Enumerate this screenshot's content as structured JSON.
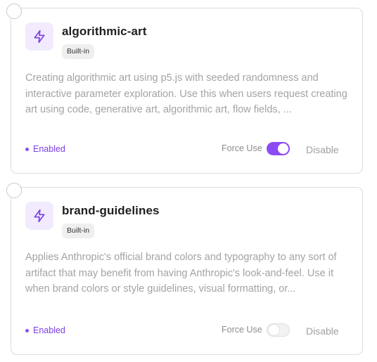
{
  "accent_color": "#8c4bf2",
  "skills": [
    {
      "name": "algorithmic-art",
      "badge": "Built-in",
      "icon": "lightning-bolt-icon",
      "description": "Creating algorithmic art using p5.js with seeded randomness and interactive parameter exploration. Use this when users request creating art using code, generative art, algorithmic art, flow fields, ...",
      "status": "Enabled",
      "force_use_label": "Force Use",
      "force_use_on": true,
      "disable_label": "Disable"
    },
    {
      "name": "brand-guidelines",
      "badge": "Built-in",
      "icon": "lightning-bolt-icon",
      "description": "Applies Anthropic's official brand colors and typography to any sort of artifact that may benefit from having Anthropic's look-and-feel. Use it when brand colors or style guidelines, visual formatting, or...",
      "status": "Enabled",
      "force_use_label": "Force Use",
      "force_use_on": false,
      "disable_label": "Disable"
    }
  ]
}
